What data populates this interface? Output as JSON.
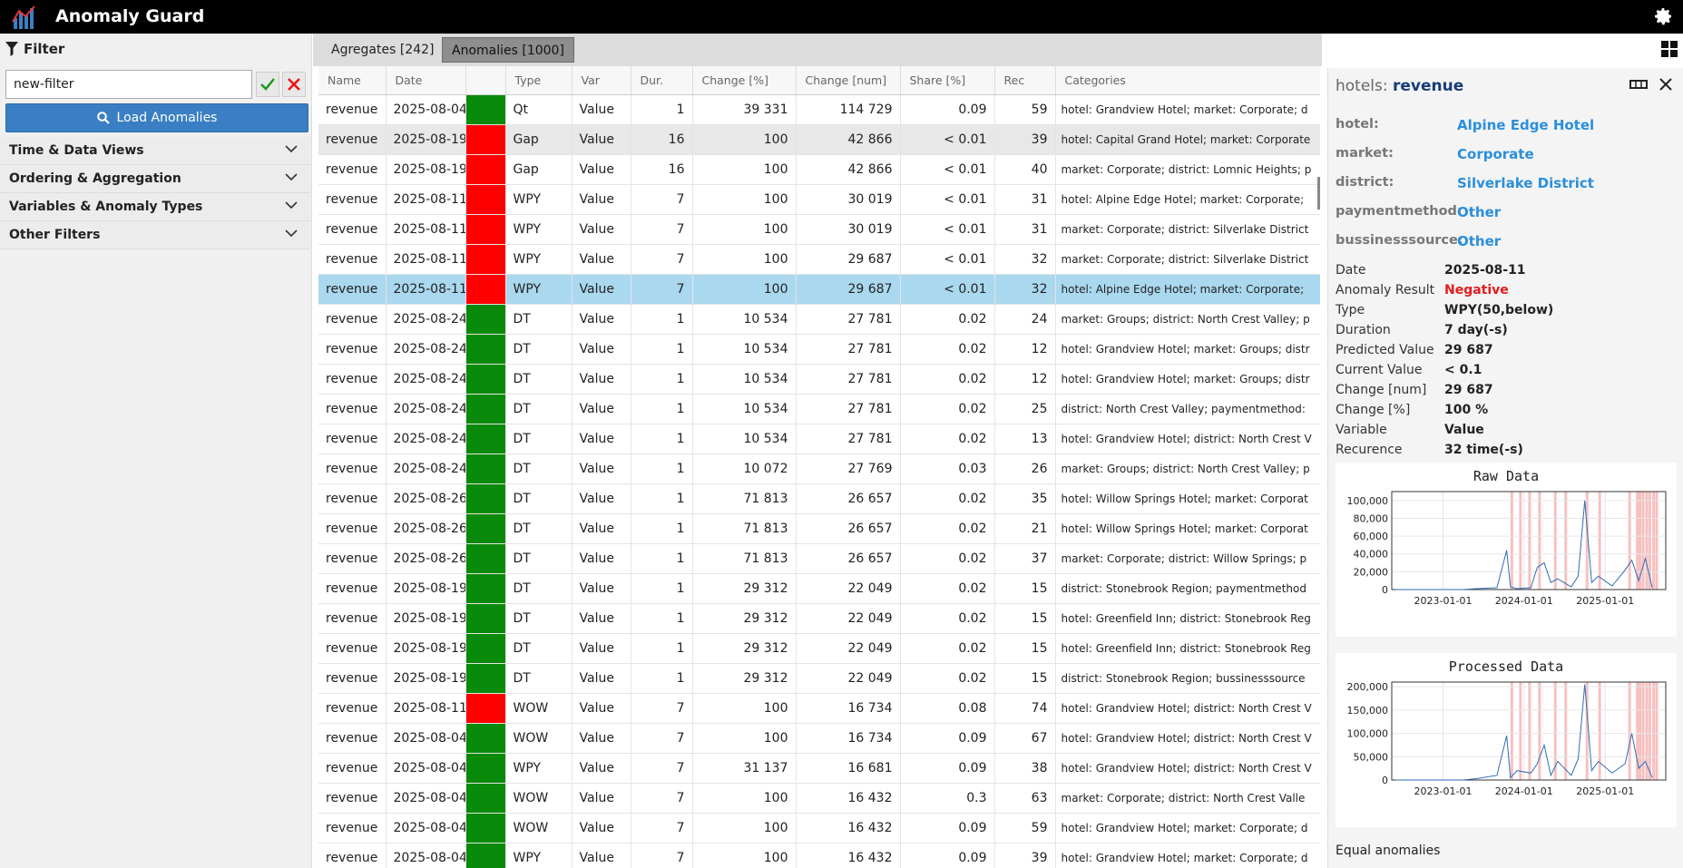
{
  "app": {
    "title": "Anomaly Guard",
    "logo_icon": "chart-logo-icon",
    "settings_icon": "gear-icon"
  },
  "sidebar": {
    "filter_label": "Filter",
    "filter_value": "new-filter",
    "load_label": "Load Anomalies",
    "sections": [
      "Time & Data Views",
      "Ordering & Aggregation",
      "Variables & Anomaly Types",
      "Other Filters"
    ]
  },
  "tabs": [
    {
      "label": "Agregates [242]",
      "active": false
    },
    {
      "label": "Anomalies [1000]",
      "active": true
    }
  ],
  "table": {
    "columns": [
      "Name",
      "Date",
      "",
      "Type",
      "Var",
      "Dur.",
      "Change [%]",
      "Change [num]",
      "Share [%]",
      "Rec",
      "Categories"
    ],
    "rows": [
      [
        "revenue",
        "2025-08-04",
        "green",
        "Qt",
        "Value",
        "1",
        "39 331",
        "114 729",
        "0.09",
        "59",
        "hotel: Grandview Hotel; market: Corporate; d"
      ],
      [
        "revenue",
        "2025-08-19",
        "red",
        "Gap",
        "Value",
        "16",
        "100",
        "42 866",
        "< 0.01",
        "39",
        "hotel: Capital Grand Hotel; market: Corporate"
      ],
      [
        "revenue",
        "2025-08-19",
        "red",
        "Gap",
        "Value",
        "16",
        "100",
        "42 866",
        "< 0.01",
        "40",
        "market: Corporate; district: Lomnic Heights; p"
      ],
      [
        "revenue",
        "2025-08-11",
        "red",
        "WPY",
        "Value",
        "7",
        "100",
        "30 019",
        "< 0.01",
        "31",
        "hotel: Alpine Edge Hotel; market: Corporate; "
      ],
      [
        "revenue",
        "2025-08-11",
        "red",
        "WPY",
        "Value",
        "7",
        "100",
        "30 019",
        "< 0.01",
        "31",
        "market: Corporate; district: Silverlake District"
      ],
      [
        "revenue",
        "2025-08-11",
        "red",
        "WPY",
        "Value",
        "7",
        "100",
        "29 687",
        "< 0.01",
        "32",
        "market: Corporate; district: Silverlake District"
      ],
      [
        "revenue",
        "2025-08-11",
        "red",
        "WPY",
        "Value",
        "7",
        "100",
        "29 687",
        "< 0.01",
        "32",
        "hotel: Alpine Edge Hotel; market: Corporate; "
      ],
      [
        "revenue",
        "2025-08-24",
        "green",
        "DT",
        "Value",
        "1",
        "10 534",
        "27 781",
        "0.02",
        "24",
        "market: Groups; district: North Crest Valley; p"
      ],
      [
        "revenue",
        "2025-08-24",
        "green",
        "DT",
        "Value",
        "1",
        "10 534",
        "27 781",
        "0.02",
        "12",
        "hotel: Grandview Hotel; market: Groups; distr"
      ],
      [
        "revenue",
        "2025-08-24",
        "green",
        "DT",
        "Value",
        "1",
        "10 534",
        "27 781",
        "0.02",
        "12",
        "hotel: Grandview Hotel; market: Groups; distr"
      ],
      [
        "revenue",
        "2025-08-24",
        "green",
        "DT",
        "Value",
        "1",
        "10 534",
        "27 781",
        "0.02",
        "25",
        "district: North Crest Valley; paymentmethod:"
      ],
      [
        "revenue",
        "2025-08-24",
        "green",
        "DT",
        "Value",
        "1",
        "10 534",
        "27 781",
        "0.02",
        "13",
        "hotel: Grandview Hotel; district: North Crest V"
      ],
      [
        "revenue",
        "2025-08-24",
        "green",
        "DT",
        "Value",
        "1",
        "10 072",
        "27 769",
        "0.03",
        "26",
        "market: Groups; district: North Crest Valley; p"
      ],
      [
        "revenue",
        "2025-08-26",
        "green",
        "DT",
        "Value",
        "1",
        "71 813",
        "26 657",
        "0.02",
        "35",
        "hotel: Willow Springs Hotel; market: Corporat"
      ],
      [
        "revenue",
        "2025-08-26",
        "green",
        "DT",
        "Value",
        "1",
        "71 813",
        "26 657",
        "0.02",
        "21",
        "hotel: Willow Springs Hotel; market: Corporat"
      ],
      [
        "revenue",
        "2025-08-26",
        "green",
        "DT",
        "Value",
        "1",
        "71 813",
        "26 657",
        "0.02",
        "37",
        "market: Corporate; district: Willow Springs; p"
      ],
      [
        "revenue",
        "2025-08-19",
        "green",
        "DT",
        "Value",
        "1",
        "29 312",
        "22 049",
        "0.02",
        "15",
        "district: Stonebrook Region; paymentmethod"
      ],
      [
        "revenue",
        "2025-08-19",
        "green",
        "DT",
        "Value",
        "1",
        "29 312",
        "22 049",
        "0.02",
        "15",
        "hotel: Greenfield Inn; district: Stonebrook Reg"
      ],
      [
        "revenue",
        "2025-08-19",
        "green",
        "DT",
        "Value",
        "1",
        "29 312",
        "22 049",
        "0.02",
        "15",
        "hotel: Greenfield Inn; district: Stonebrook Reg"
      ],
      [
        "revenue",
        "2025-08-19",
        "green",
        "DT",
        "Value",
        "1",
        "29 312",
        "22 049",
        "0.02",
        "15",
        "district: Stonebrook Region; bussinesssource"
      ],
      [
        "revenue",
        "2025-08-11",
        "red",
        "WOW",
        "Value",
        "7",
        "100",
        "16 734",
        "0.08",
        "74",
        "hotel: Grandview Hotel; district: North Crest V"
      ],
      [
        "revenue",
        "2025-08-04",
        "green",
        "WOW",
        "Value",
        "7",
        "100",
        "16 734",
        "0.09",
        "67",
        "hotel: Grandview Hotel; district: North Crest V"
      ],
      [
        "revenue",
        "2025-08-04",
        "green",
        "WPY",
        "Value",
        "7",
        "31 137",
        "16 681",
        "0.09",
        "38",
        "hotel: Grandview Hotel; district: North Crest V"
      ],
      [
        "revenue",
        "2025-08-04",
        "green",
        "WOW",
        "Value",
        "7",
        "100",
        "16 432",
        "0.3",
        "63",
        "market: Corporate; district: North Crest Valle"
      ],
      [
        "revenue",
        "2025-08-04",
        "green",
        "WOW",
        "Value",
        "7",
        "100",
        "16 432",
        "0.09",
        "59",
        "hotel: Grandview Hotel; market: Corporate; d"
      ],
      [
        "revenue",
        "2025-08-04",
        "green",
        "WPY",
        "Value",
        "7",
        "100",
        "16 432",
        "0.09",
        "39",
        "hotel: Grandview Hotel; market: Corporate; d"
      ]
    ],
    "selected_row": 6,
    "hover_row": 1
  },
  "detail": {
    "head_key": "hotels:",
    "head_value": "revenue",
    "dims": [
      {
        "k": "hotel:",
        "v": "Alpine Edge Hotel"
      },
      {
        "k": "market:",
        "v": "Corporate"
      },
      {
        "k": "district:",
        "v": "Silverlake District"
      },
      {
        "k": "paymentmethod:",
        "v": "Other"
      },
      {
        "k": "bussinesssource:",
        "v": "Other"
      }
    ],
    "props": [
      {
        "k": "Date",
        "v": "2025-08-11"
      },
      {
        "k": "Anomaly Result",
        "v": "Negative",
        "neg": true
      },
      {
        "k": "Type",
        "v": "WPY(50,below)"
      },
      {
        "k": "Duration",
        "v": "7 day(-s)"
      },
      {
        "k": "Predicted Value",
        "v": "29 687"
      },
      {
        "k": "Current Value",
        "v": "< 0.1"
      },
      {
        "k": "Change [num]",
        "v": "29 687"
      },
      {
        "k": "Change [%]",
        "v": "100 %"
      },
      {
        "k": "Variable",
        "v": "Value"
      },
      {
        "k": "Recurence",
        "v": "32 time(-s)"
      }
    ],
    "equal_label": "Equal anomalies"
  },
  "chart_data": [
    {
      "type": "line",
      "title": "Raw Data",
      "yticks": [
        "100,000",
        "80,000",
        "60,000",
        "40,000",
        "20,000",
        "0"
      ],
      "xticks": [
        "2023-01-01",
        "2024-01-01",
        "2025-01-01"
      ],
      "ylim": [
        0,
        110000
      ],
      "grid": true,
      "series": [
        {
          "x": [
            "2022-06-01",
            "2022-09-01",
            "2023-01-01",
            "2023-04-01",
            "2023-06-01",
            "2023-09-01",
            "2023-10-15",
            "2023-11-01",
            "2023-12-01",
            "2024-02-01",
            "2024-03-01",
            "2024-04-01",
            "2024-05-01",
            "2024-06-01",
            "2024-08-01",
            "2024-09-01",
            "2024-10-01",
            "2024-11-01",
            "2024-12-01",
            "2025-02-01",
            "2025-04-01",
            "2025-05-01",
            "2025-06-01",
            "2025-07-01",
            "2025-08-01"
          ],
          "y": [
            0,
            0,
            0,
            0,
            1000,
            2000,
            44000,
            3000,
            1000,
            2000,
            25000,
            30000,
            8000,
            12000,
            3000,
            15000,
            100000,
            8000,
            15000,
            4000,
            22000,
            33000,
            10000,
            35000,
            2000
          ]
        }
      ],
      "highlight_bands_color": "#f4a5a5"
    },
    {
      "type": "line",
      "title": "Processed Data",
      "yticks": [
        "200,000",
        "150,000",
        "100,000",
        "50,000",
        "0"
      ],
      "xticks": [
        "2023-01-01",
        "2024-01-01",
        "2025-01-01"
      ],
      "ylim": [
        0,
        210000
      ],
      "grid": true,
      "series": [
        {
          "x": [
            "2022-06-01",
            "2022-09-01",
            "2023-01-01",
            "2023-04-01",
            "2023-06-01",
            "2023-09-01",
            "2023-10-15",
            "2023-11-01",
            "2023-12-01",
            "2024-02-01",
            "2024-03-01",
            "2024-04-01",
            "2024-05-01",
            "2024-06-01",
            "2024-08-01",
            "2024-09-01",
            "2024-10-01",
            "2024-11-01",
            "2024-12-01",
            "2025-02-01",
            "2025-04-01",
            "2025-05-01",
            "2025-06-01",
            "2025-07-01",
            "2025-08-01"
          ],
          "y": [
            0,
            0,
            0,
            0,
            3000,
            10000,
            95000,
            5000,
            20000,
            15000,
            35000,
            75000,
            10000,
            40000,
            10000,
            45000,
            205000,
            20000,
            40000,
            15000,
            35000,
            100000,
            25000,
            40000,
            5000
          ]
        }
      ],
      "highlight_bands_color": "#f4a5a5"
    }
  ]
}
